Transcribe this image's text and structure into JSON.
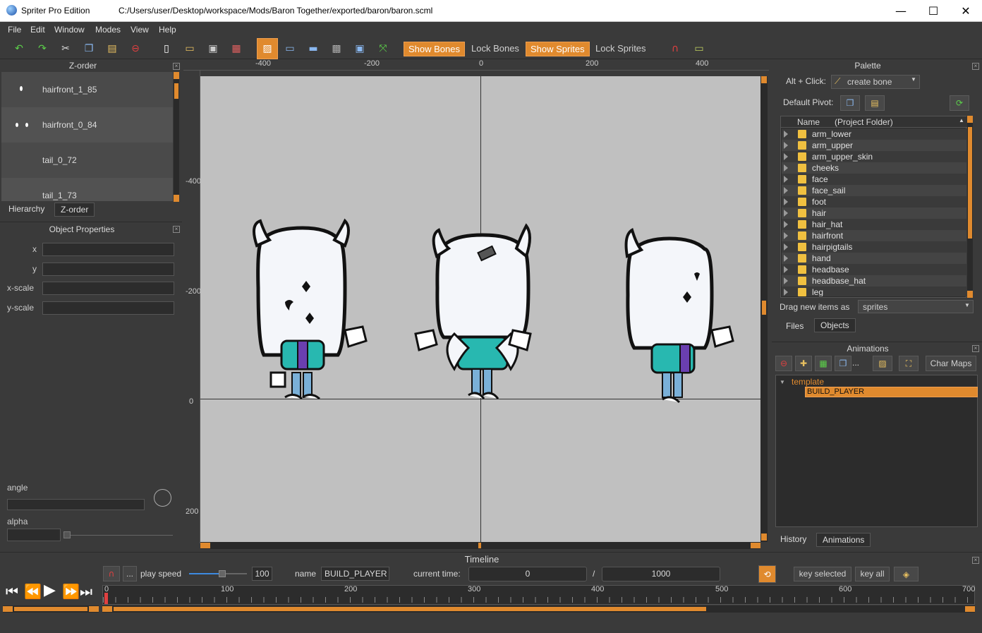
{
  "window": {
    "app_title": "Spriter Pro Edition",
    "file_path": "C:/Users/user/Desktop/workspace/Mods/Baron Together/exported/baron/baron.scml",
    "minimize": "—",
    "maximize": "☐",
    "close": "✕"
  },
  "menu": [
    "File",
    "Edit",
    "Window",
    "Modes",
    "View",
    "Help"
  ],
  "toolbar": {
    "show_bones": "Show Bones",
    "lock_bones": "Lock Bones",
    "show_sprites": "Show Sprites",
    "lock_sprites": "Lock Sprites"
  },
  "zorder": {
    "title": "Z-order",
    "items": [
      "hairfront_1_85",
      "hairfront_0_84",
      "tail_0_72",
      "tail_1_73"
    ],
    "tabs": [
      "Hierarchy",
      "Z-order"
    ]
  },
  "object_properties": {
    "title": "Object Properties",
    "fields": [
      "x",
      "y",
      "x-scale",
      "y-scale"
    ],
    "angle_label": "angle",
    "alpha_label": "alpha"
  },
  "canvas": {
    "ruler_top": [
      "-400",
      "-200",
      "0",
      "200",
      "400"
    ],
    "ruler_left": [
      "-400",
      "-200",
      "0",
      "200"
    ],
    "bg_color": "#c0c0c0"
  },
  "palette": {
    "title": "Palette",
    "alt_click_label": "Alt + Click:",
    "alt_click_value": "create bone",
    "default_pivot_label": "Default Pivot:",
    "col_name": "Name",
    "col_folder": "(Project Folder)",
    "folders": [
      "arm_lower",
      "arm_upper",
      "arm_upper_skin",
      "cheeks",
      "face",
      "face_sail",
      "foot",
      "hair",
      "hair_hat",
      "hairfront",
      "hairpigtails",
      "hand",
      "headbase",
      "headbase_hat",
      "leg"
    ],
    "drag_label": "Drag new items as",
    "drag_value": "sprites",
    "tabs": [
      "Files",
      "Objects"
    ]
  },
  "animations": {
    "title": "Animations",
    "char_maps": "Char Maps",
    "more": "...",
    "entity": "template",
    "animation": "BUILD_PLAYER",
    "tabs": [
      "History",
      "Animations"
    ]
  },
  "timeline": {
    "title": "Timeline",
    "more": "...",
    "play_speed_label": "play speed",
    "play_speed_value": "100",
    "name_label": "name",
    "name_value": "BUILD_PLAYER",
    "current_time_label": "current time:",
    "current_time": "0",
    "slash": "/",
    "total_time": "1000",
    "key_selected": "key selected",
    "key_all": "key all",
    "ticks": [
      "100",
      "200",
      "300",
      "400",
      "500",
      "600",
      "700"
    ]
  },
  "accent_color": "#e08a2e"
}
